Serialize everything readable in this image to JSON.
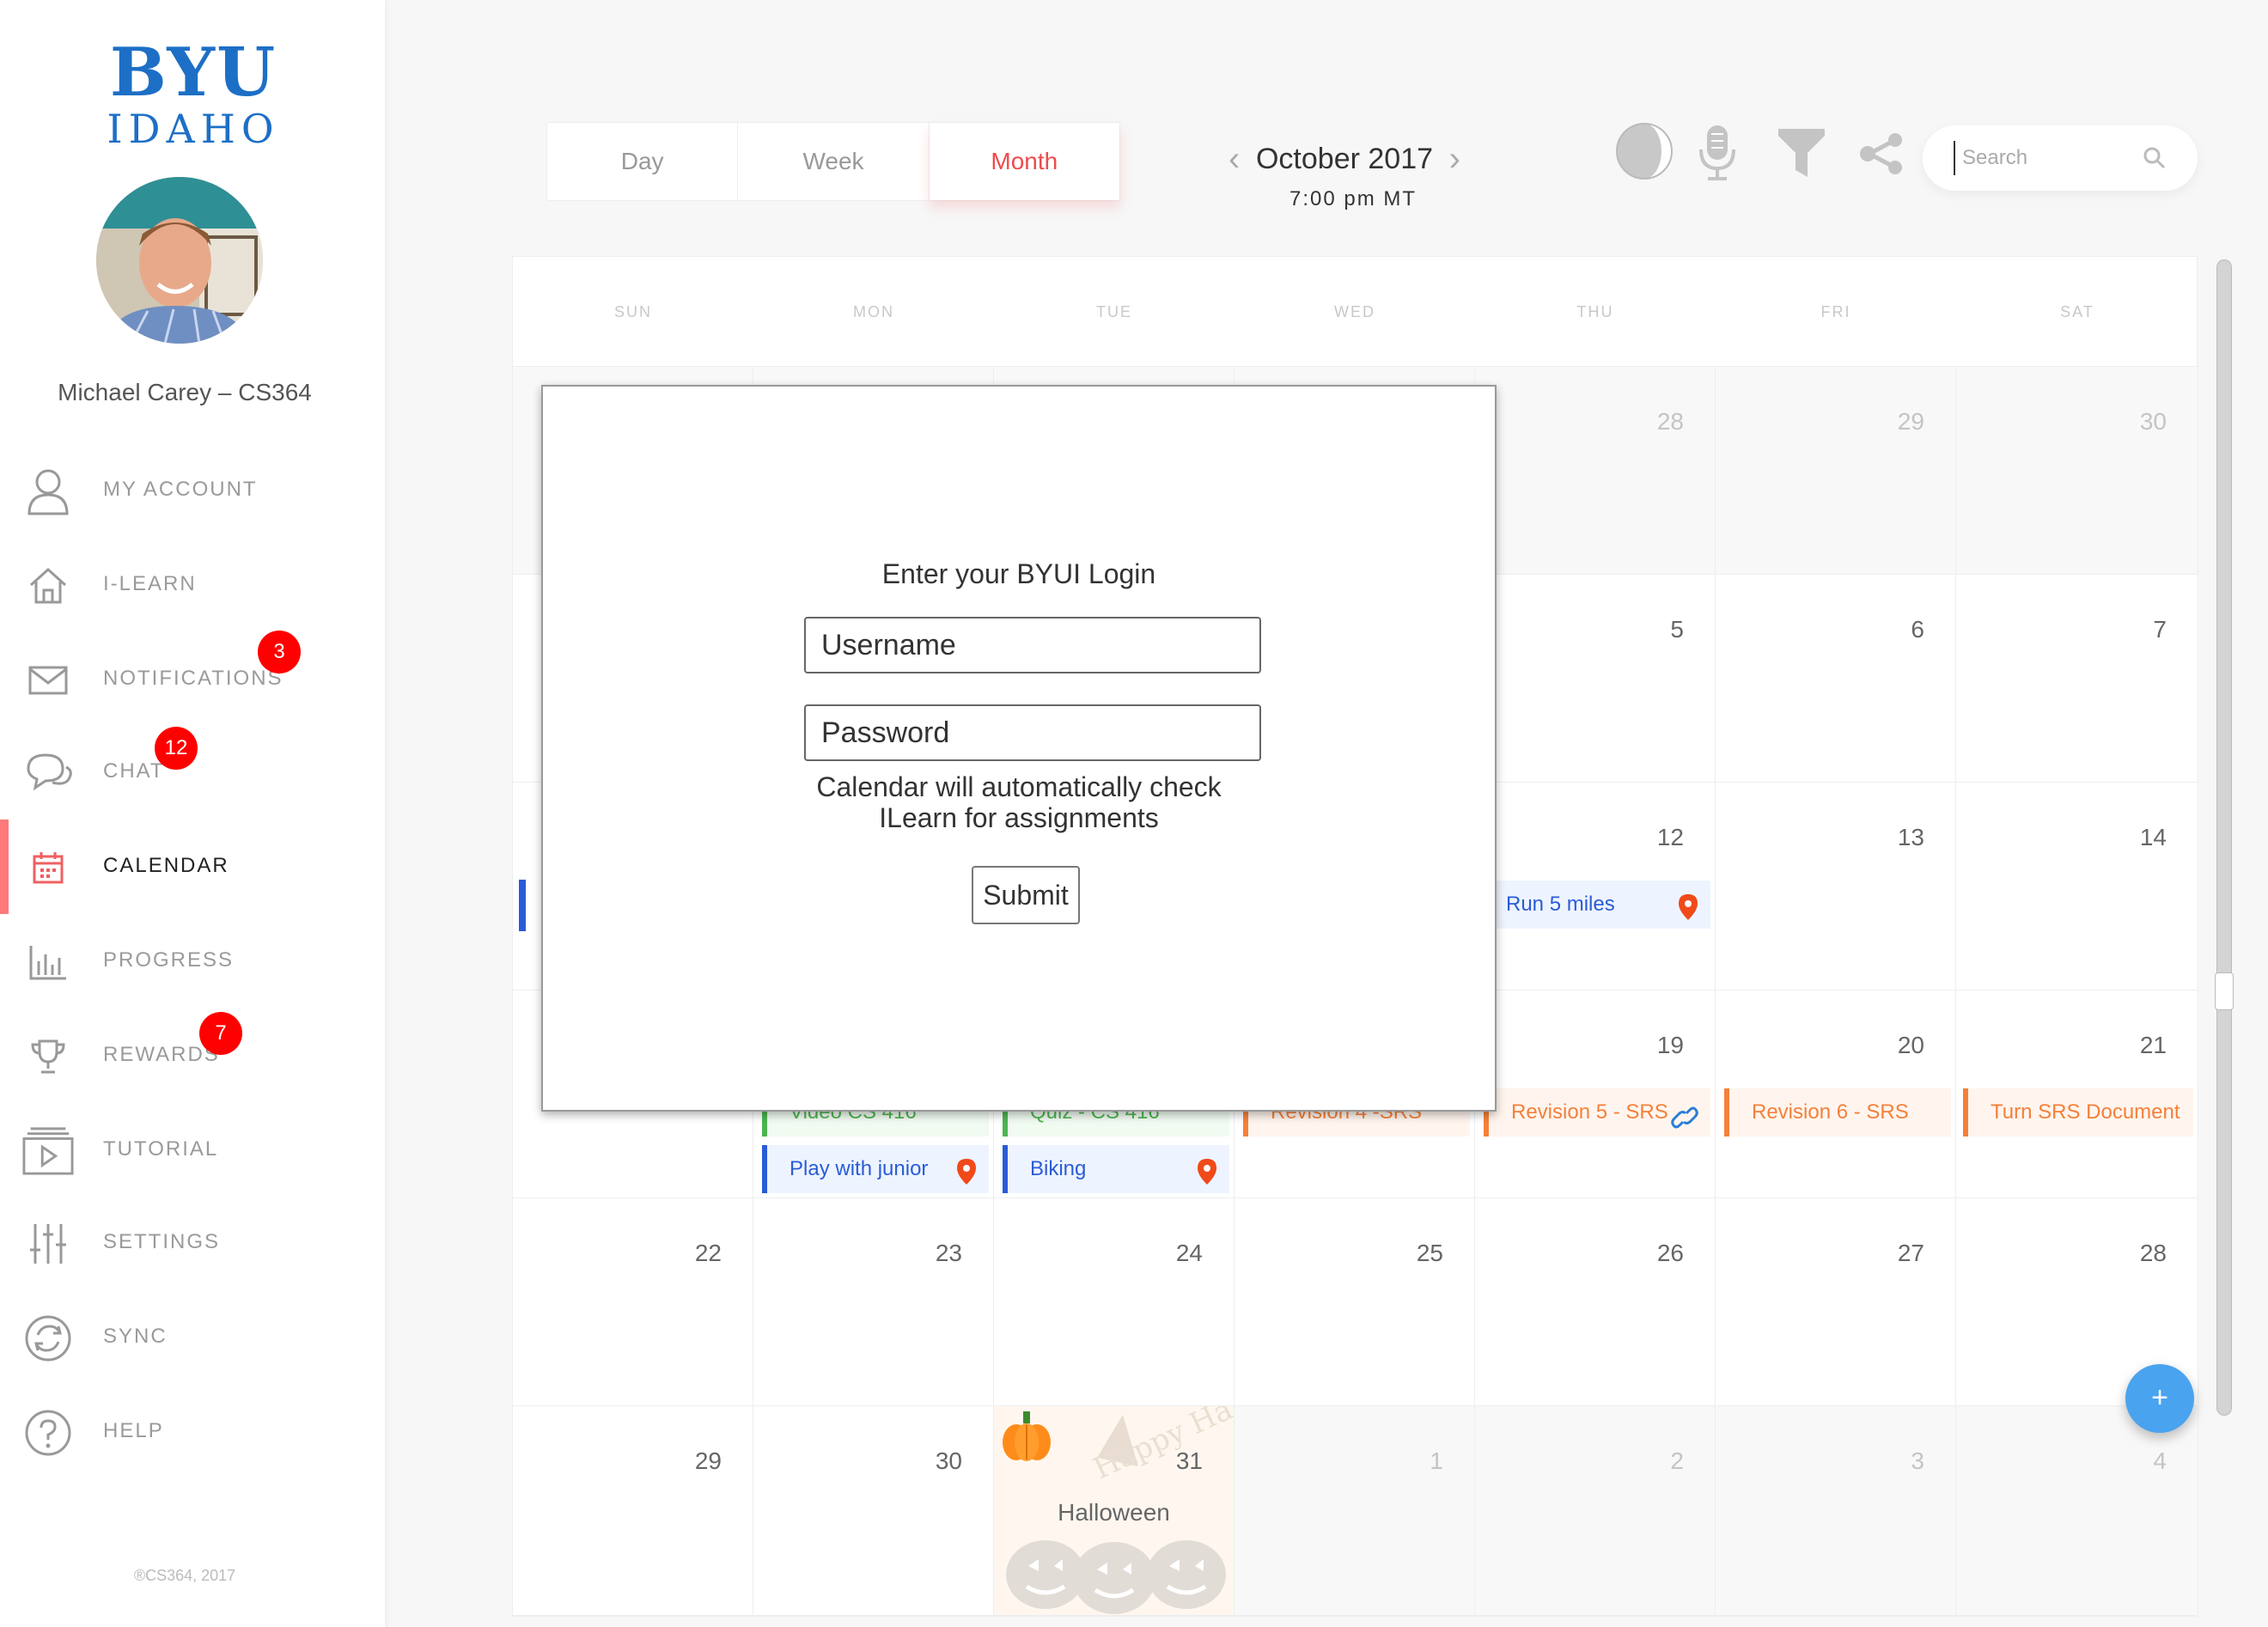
{
  "sidebar": {
    "logo_top": "BYU",
    "logo_bottom": "IDAHO",
    "user_name": "Michael Carey – CS364",
    "items": [
      {
        "label": "MY ACCOUNT",
        "icon": "user-icon"
      },
      {
        "label": "I-LEARN",
        "icon": "home-icon"
      },
      {
        "label": "NOTIFICATIONS",
        "icon": "mail-icon",
        "badge": "3"
      },
      {
        "label": "CHAT",
        "icon": "chat-icon",
        "badge": "12"
      },
      {
        "label": "CALENDAR",
        "icon": "calendar-icon",
        "active": true
      },
      {
        "label": "PROGRESS",
        "icon": "bar-chart-icon"
      },
      {
        "label": "REWARDS",
        "icon": "trophy-icon",
        "badge": "7"
      },
      {
        "label": "TUTORIAL",
        "icon": "video-play-icon"
      },
      {
        "label": "SETTINGS",
        "icon": "sliders-icon"
      },
      {
        "label": "SYNC",
        "icon": "sync-icon"
      },
      {
        "label": "HELP",
        "icon": "help-icon"
      }
    ],
    "copyright": "®CS364, 2017"
  },
  "header": {
    "tabs": [
      "Day",
      "Week",
      "Month"
    ],
    "active_tab": "Month",
    "month_title": "October 2017",
    "time": "7:00 pm MT",
    "tools": [
      "moon-phase-icon",
      "microphone-icon",
      "filter-icon",
      "share-icon"
    ],
    "search_placeholder": "Search"
  },
  "calendar": {
    "weekdays": [
      "SUN",
      "MON",
      "TUE",
      "WED",
      "THU",
      "FRI",
      "SAT"
    ],
    "weeks": [
      [
        "",
        "",
        "",
        "",
        "28",
        "29",
        "30"
      ],
      [
        "",
        "",
        "",
        "",
        "5",
        "6",
        "7"
      ],
      [
        "",
        "",
        "",
        "",
        "12",
        "13",
        "14"
      ],
      [
        "",
        "",
        "",
        "",
        "19",
        "20",
        "21"
      ],
      [
        "22",
        "23",
        "24",
        "25",
        "26",
        "27",
        "28"
      ],
      [
        "29",
        "30",
        "31",
        "1",
        "2",
        "3",
        "4"
      ]
    ],
    "events": {
      "run": "Run 5 miles",
      "video": "Video CS 416",
      "quiz": "Quiz - CS 416",
      "rev4": "Revision 4 -SRS",
      "rev5": "Revision 5 - SRS",
      "rev6": "Revision 6 - SRS",
      "turn_srs": "Turn SRS Document",
      "play": "Play with junior",
      "biking": "Biking"
    },
    "holiday": "Halloween",
    "holiday_art_text": "Happy Halloween",
    "colors": {
      "personal": "#2a5cd8",
      "assignment": "#f5803a",
      "class": "#4cb450",
      "accent": "#f04a4a"
    }
  },
  "modal": {
    "title": "Enter your BYUI Login",
    "username_placeholder": "Username",
    "password_placeholder": "Password",
    "note_line1": "Calendar will automatically check",
    "note_line2": "ILearn for assignments",
    "submit": "Submit"
  },
  "fab": "+"
}
